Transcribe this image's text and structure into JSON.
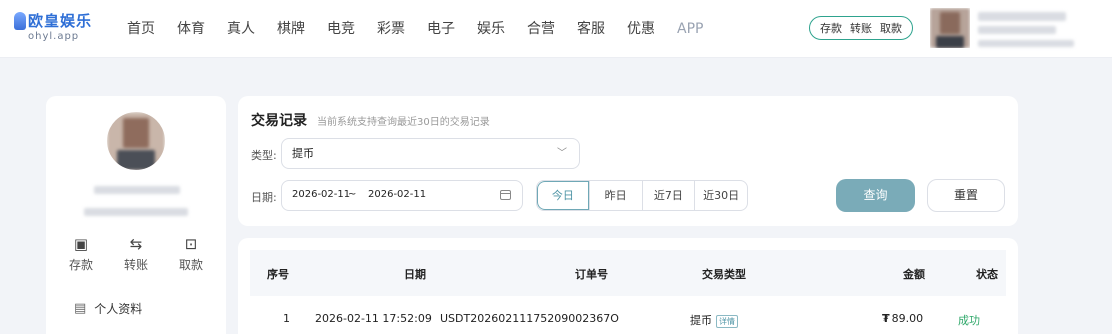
{
  "brand": {
    "name_cn": "欧皇娱乐",
    "name_en": "ohyl.app",
    "accent": "#2f6fd6"
  },
  "nav": [
    "首页",
    "体育",
    "真人",
    "棋牌",
    "电竞",
    "彩票",
    "电子",
    "娱乐",
    "合营",
    "客服",
    "优惠",
    "APP"
  ],
  "quick_actions": [
    "存款",
    "转账",
    "取款"
  ],
  "sidebar": {
    "actions": [
      {
        "icon": "wallet-icon",
        "label": "存款"
      },
      {
        "icon": "transfer-icon",
        "label": "转账"
      },
      {
        "icon": "withdraw-icon",
        "label": "取款"
      }
    ],
    "menu": [
      {
        "icon": "profile-card-icon",
        "label": "个人资料"
      }
    ]
  },
  "filter": {
    "title": "交易记录",
    "subtitle": "当前系统支持查询最近30日的交易记录",
    "type_label": "类型:",
    "type_value": "提币",
    "date_label": "日期:",
    "date_start": "2026-02-11",
    "date_sep": "~",
    "date_end": "2026-02-11",
    "ranges": [
      "今日",
      "昨日",
      "近7日",
      "近30日"
    ],
    "active_range": "今日",
    "query_label": "查询",
    "reset_label": "重置",
    "query_color": "#7aabb8"
  },
  "table": {
    "columns": [
      "序号",
      "日期",
      "订单号",
      "交易类型",
      "金额",
      "状态"
    ],
    "rows": [
      {
        "index": "1",
        "date": "2026-02-11 17:52:09",
        "order": "USDT20260211175209002367O",
        "type": "提币",
        "detail_tag": "详情",
        "amount_symbol": "₮",
        "amount": "89.00",
        "status": "成功"
      }
    ]
  },
  "status_colors": {
    "success": "#2fa86a"
  }
}
